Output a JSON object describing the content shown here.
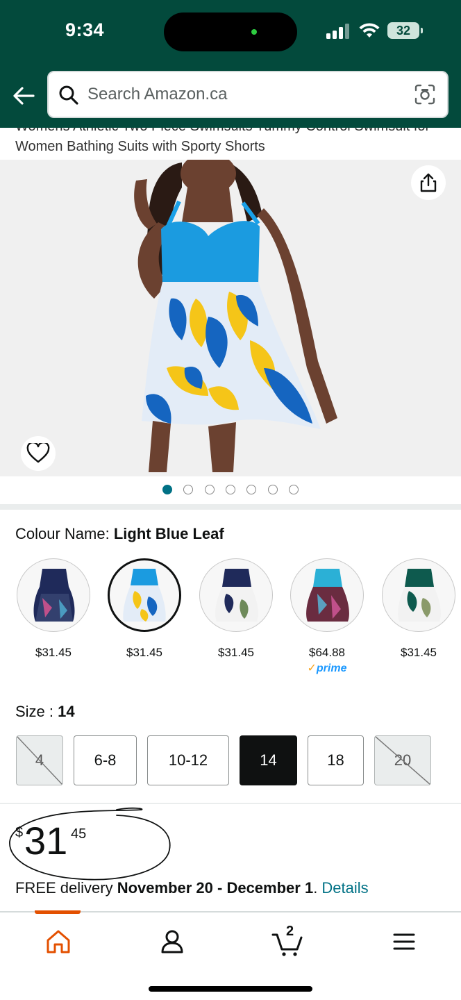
{
  "status_bar": {
    "time": "9:34",
    "battery": "32"
  },
  "search": {
    "placeholder": "Search Amazon.ca"
  },
  "product": {
    "title_line1": "Womens Athletic Two Piece Swimsuits Tummy Control Swimsuit for",
    "title_line2": "Women Bathing Suits with Sporty Shorts"
  },
  "carousel": {
    "total": 7,
    "active_index": 0
  },
  "colour": {
    "label": "Colour Name: ",
    "selected": "Light Blue Leaf",
    "swatches": [
      {
        "price": "$31.45",
        "prime": ""
      },
      {
        "price": "$31.45",
        "prime": ""
      },
      {
        "price": "$31.45",
        "prime": ""
      },
      {
        "price": "$64.88",
        "prime": "prime"
      },
      {
        "price": "$31.45",
        "prime": ""
      }
    ]
  },
  "size": {
    "label": "Size : ",
    "selected": "14",
    "options": [
      "4",
      "6-8",
      "10-12",
      "14",
      "18",
      "20"
    ]
  },
  "price": {
    "symbol": "$",
    "whole": "31",
    "fraction": "45"
  },
  "delivery": {
    "prefix": "FREE delivery ",
    "dates": "November 20 - December 1",
    "suffix": ". ",
    "link": "Details"
  },
  "cart": {
    "count": "2"
  },
  "colors": {
    "header": "#034a3c",
    "link": "#007185",
    "accent": "#e35000"
  }
}
